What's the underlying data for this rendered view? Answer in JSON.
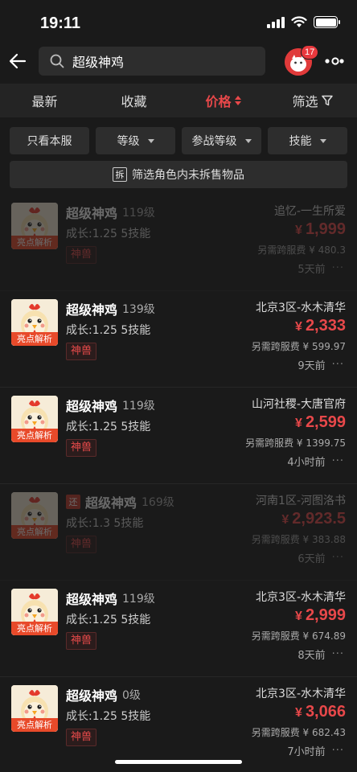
{
  "status": {
    "time": "19:11"
  },
  "header": {
    "search_text": "超级神鸡",
    "badge_count": "17"
  },
  "tabs": [
    {
      "label": "最新"
    },
    {
      "label": "收藏"
    },
    {
      "label": "价格"
    },
    {
      "label": "筛选"
    }
  ],
  "filters": [
    {
      "label": "只看本服"
    },
    {
      "label": "等级"
    },
    {
      "label": "参战等级"
    },
    {
      "label": "技能"
    }
  ],
  "exclude": {
    "icon_text": "拆",
    "label": "筛选角色内未拆售物品"
  },
  "items": [
    {
      "tag": "亮点解析",
      "name": "超级神鸡",
      "level": "119级",
      "growth": "成长:1.25 5技能",
      "beast": "神兽",
      "server": "追忆-一生所爱",
      "currency": "¥",
      "price": "1,999",
      "fee": "另需跨服费 ¥ 480.3",
      "time": "5天前",
      "more": "···",
      "dim": true
    },
    {
      "tag": "亮点解析",
      "name": "超级神鸡",
      "level": "139级",
      "growth": "成长:1.25 5技能",
      "beast": "神兽",
      "server": "北京3区-水木清华",
      "currency": "¥",
      "price": "2,333",
      "fee": "另需跨服费 ¥ 599.97",
      "time": "9天前",
      "more": "···"
    },
    {
      "tag": "亮点解析",
      "name": "超级神鸡",
      "level": "119级",
      "growth": "成长:1.25 5技能",
      "beast": "神兽",
      "server": "山河社稷-大唐官府",
      "currency": "¥",
      "price": "2,599",
      "fee": "另需跨服费 ¥ 1399.75",
      "time": "4小时前",
      "more": "···"
    },
    {
      "tag": "亮点解析",
      "refund": "还",
      "name": "超级神鸡",
      "level": "169级",
      "growth": "成长:1.3 5技能",
      "beast": "神兽",
      "server": "河南1区-河图洛书",
      "currency": "¥",
      "price": "2,923.5",
      "fee": "另需跨服费 ¥ 383.88",
      "time": "6天前",
      "more": "···",
      "dim": true
    },
    {
      "tag": "亮点解析",
      "name": "超级神鸡",
      "level": "119级",
      "growth": "成长:1.25 5技能",
      "beast": "神兽",
      "server": "北京3区-水木清华",
      "currency": "¥",
      "price": "2,999",
      "fee": "另需跨服费 ¥ 674.89",
      "time": "8天前",
      "more": "···"
    },
    {
      "tag": "亮点解析",
      "name": "超级神鸡",
      "level": "0级",
      "growth": "成长:1.25 5技能",
      "beast": "神兽",
      "server": "北京3区-水木清华",
      "currency": "¥",
      "price": "3,066",
      "fee": "另需跨服费 ¥ 682.43",
      "time": "7小时前",
      "more": "···"
    }
  ]
}
